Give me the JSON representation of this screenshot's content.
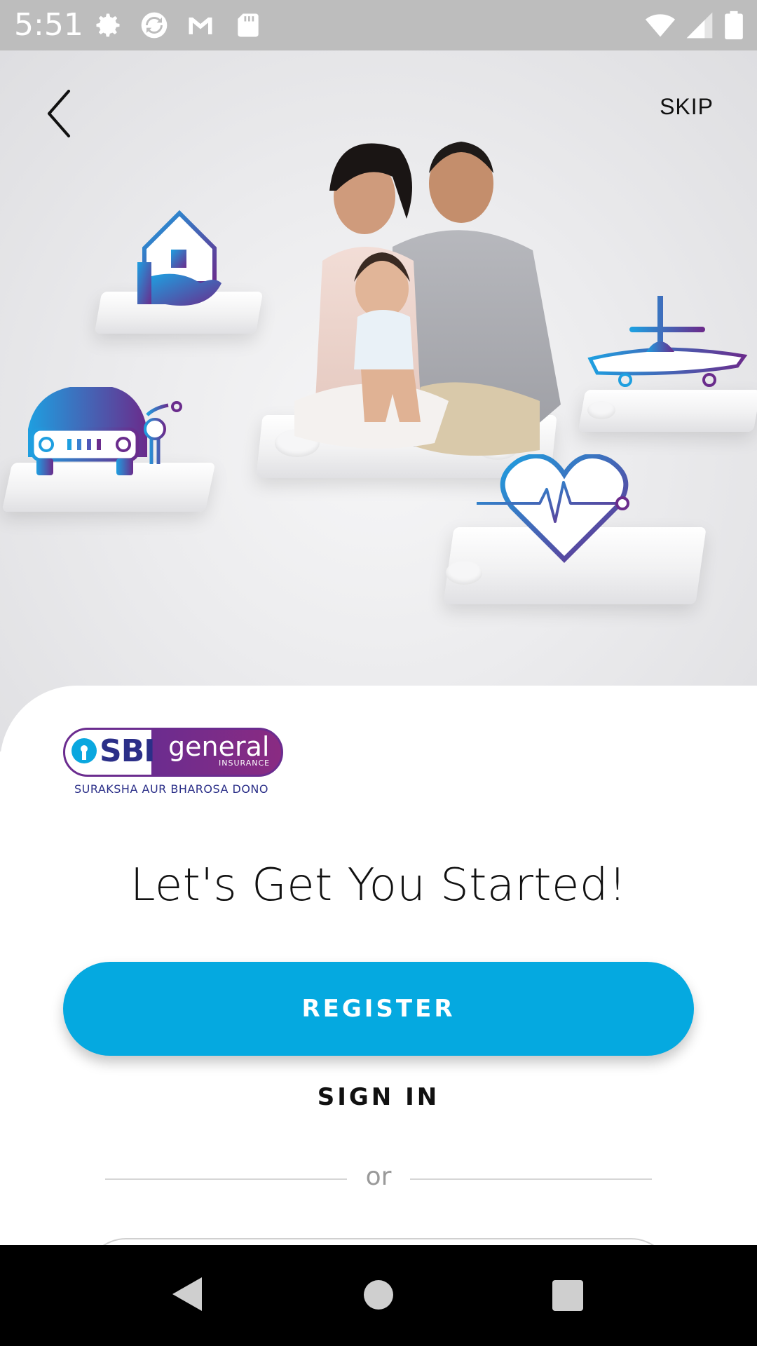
{
  "status_bar": {
    "time": "5:51",
    "left_icons": [
      "gear-icon",
      "sync-icon",
      "gmail-icon",
      "sd-card-icon"
    ],
    "right_icons": [
      "wifi-icon",
      "signal-icon",
      "battery-icon"
    ]
  },
  "header": {
    "skip_label": "SKIP"
  },
  "hero": {
    "icons": [
      "home-insurance-icon",
      "car-bike-insurance-icon",
      "airplane-travel-icon",
      "heart-health-icon"
    ]
  },
  "logo": {
    "brand": "SBI",
    "product": "general",
    "sub": "INSURANCE",
    "tagline": "SURAKSHA AUR BHAROSA DONO"
  },
  "main": {
    "headline": "Let's Get You Started!",
    "register_label": "REGISTER",
    "signin_label": "SIGN IN",
    "divider_text": "or"
  },
  "colors": {
    "accent": "#05a9e0",
    "brand_purple": "#6b2c8f",
    "brand_blue": "#2b2f88"
  }
}
